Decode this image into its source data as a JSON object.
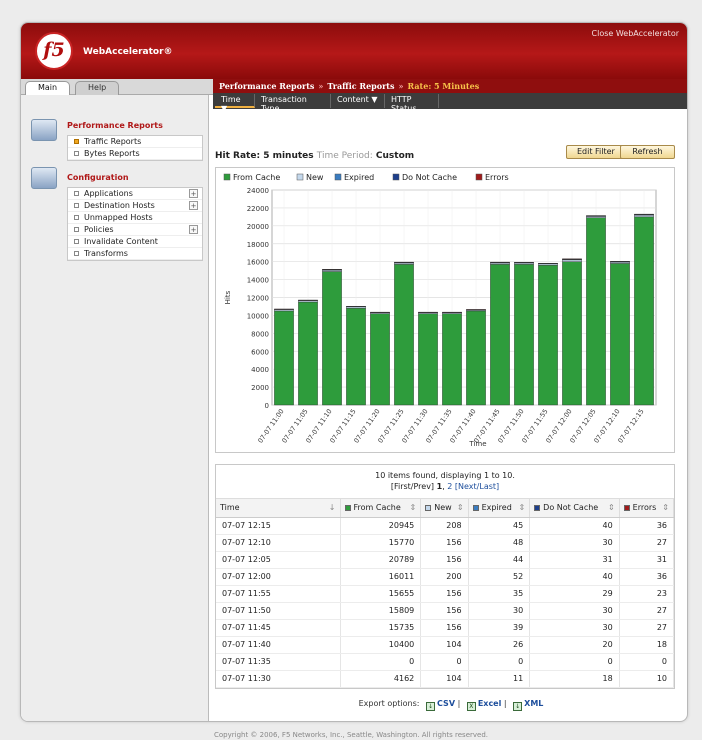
{
  "app": {
    "logo_text": "f5",
    "product_name": "WebAccelerator®",
    "close_link": "Close WebAccelerator"
  },
  "sidebar": {
    "tabs": [
      "Main",
      "Help"
    ],
    "sections": [
      {
        "title": "Performance Reports",
        "items": [
          {
            "label": "Traffic Reports",
            "active": true,
            "has_plus": false
          },
          {
            "label": "Bytes Reports",
            "active": false,
            "has_plus": false
          }
        ]
      },
      {
        "title": "Configuration",
        "items": [
          {
            "label": "Applications",
            "active": false,
            "has_plus": true
          },
          {
            "label": "Destination Hosts",
            "active": false,
            "has_plus": true
          },
          {
            "label": "Unmapped Hosts",
            "active": false,
            "has_plus": false
          },
          {
            "label": "Policies",
            "active": false,
            "has_plus": true
          },
          {
            "label": "Invalidate Content",
            "active": false,
            "has_plus": false
          },
          {
            "label": "Transforms",
            "active": false,
            "has_plus": false
          }
        ]
      }
    ]
  },
  "breadcrumb": {
    "items": [
      "Performance Reports",
      "Traffic Reports",
      "Rate: 5 Minutes"
    ],
    "separator": "»"
  },
  "report_tabs": [
    {
      "label": "Time",
      "has_menu": true,
      "active": true
    },
    {
      "label": "Transaction Type",
      "has_menu": false,
      "active": false
    },
    {
      "label": "Content",
      "has_menu": true,
      "active": false
    },
    {
      "label": "HTTP Status",
      "has_menu": false,
      "active": false
    }
  ],
  "report": {
    "title_prefix": "Hit Rate: 5 minutes",
    "period_label": "Time Period:",
    "period_value": "Custom",
    "edit_filter": "Edit Filter",
    "refresh": "Refresh"
  },
  "chart_data": {
    "type": "bar",
    "stacked": true,
    "xlabel": "Time",
    "ylabel": "Hits",
    "ylim": [
      0,
      24000
    ],
    "yticks": [
      0,
      2000,
      4000,
      6000,
      8000,
      10000,
      12000,
      14000,
      16000,
      18000,
      20000,
      22000,
      24000
    ],
    "grid": true,
    "legend_position": "top",
    "categories": [
      "07-07 11:00",
      "07-07 11:05",
      "07-07 11:10",
      "07-07 11:15",
      "07-07 11:20",
      "07-07 11:25",
      "07-07 11:30",
      "07-07 11:35",
      "07-07 11:40",
      "07-07 11:45",
      "07-07 11:50",
      "07-07 11:55",
      "07-07 12:00",
      "07-07 12:05",
      "07-07 12:10",
      "07-07 12:15"
    ],
    "series": [
      {
        "name": "From Cache",
        "color": "#2e9c3c",
        "values": [
          10500,
          11500,
          14900,
          10800,
          10200,
          15700,
          10200,
          10200,
          10500,
          15700,
          15700,
          15600,
          16000,
          20900,
          15800,
          21000
        ]
      },
      {
        "name": "New",
        "color": "#c4d8ec",
        "values": [
          150,
          150,
          150,
          150,
          100,
          150,
          100,
          100,
          100,
          150,
          150,
          150,
          200,
          150,
          150,
          200
        ]
      },
      {
        "name": "Expired",
        "color": "#3a7cc0",
        "values": [
          30,
          30,
          40,
          30,
          30,
          40,
          30,
          30,
          30,
          40,
          30,
          30,
          50,
          40,
          40,
          40
        ]
      },
      {
        "name": "Do Not Cache",
        "color": "#1d3f8c",
        "values": [
          20,
          20,
          30,
          20,
          20,
          30,
          20,
          20,
          20,
          30,
          30,
          30,
          40,
          30,
          30,
          40
        ]
      },
      {
        "name": "Errors",
        "color": "#a01b1b",
        "values": [
          20,
          20,
          30,
          20,
          20,
          30,
          20,
          20,
          20,
          30,
          30,
          20,
          30,
          30,
          30,
          30
        ]
      }
    ]
  },
  "table": {
    "summary": "10 items found, displaying 1 to 10.",
    "pager_prefix": "[First/Prev] ",
    "pager_pages": [
      "1",
      "2"
    ],
    "pager_links": "[Next/Last]",
    "columns": [
      {
        "label": "Time",
        "color": null
      },
      {
        "label": "From Cache",
        "color": "#2e9c3c"
      },
      {
        "label": "New",
        "color": "#c4d8ec"
      },
      {
        "label": "Expired",
        "color": "#3a7cc0"
      },
      {
        "label": "Do Not Cache",
        "color": "#1d3f8c"
      },
      {
        "label": "Errors",
        "color": "#a01b1b"
      }
    ],
    "rows": [
      [
        "07-07 12:15",
        "20945",
        "208",
        "45",
        "40",
        "36"
      ],
      [
        "07-07 12:10",
        "15770",
        "156",
        "48",
        "30",
        "27"
      ],
      [
        "07-07 12:05",
        "20789",
        "156",
        "44",
        "31",
        "31"
      ],
      [
        "07-07 12:00",
        "16011",
        "200",
        "52",
        "40",
        "36"
      ],
      [
        "07-07 11:55",
        "15655",
        "156",
        "35",
        "29",
        "23"
      ],
      [
        "07-07 11:50",
        "15809",
        "156",
        "30",
        "30",
        "27"
      ],
      [
        "07-07 11:45",
        "15735",
        "156",
        "39",
        "30",
        "27"
      ],
      [
        "07-07 11:40",
        "10400",
        "104",
        "26",
        "20",
        "18"
      ],
      [
        "07-07 11:35",
        "0",
        "0",
        "0",
        "0",
        "0"
      ],
      [
        "07-07 11:30",
        "4162",
        "104",
        "11",
        "18",
        "10"
      ]
    ]
  },
  "export": {
    "label": "Export options:",
    "options": [
      {
        "label": "CSV",
        "icon": "csv-icon"
      },
      {
        "label": "Excel",
        "icon": "excel-icon"
      },
      {
        "label": "XML",
        "icon": "xml-icon"
      }
    ]
  },
  "footer": {
    "copyright": "Copyright © 2006, F5 Networks, Inc., Seattle, Washington. All rights reserved."
  }
}
